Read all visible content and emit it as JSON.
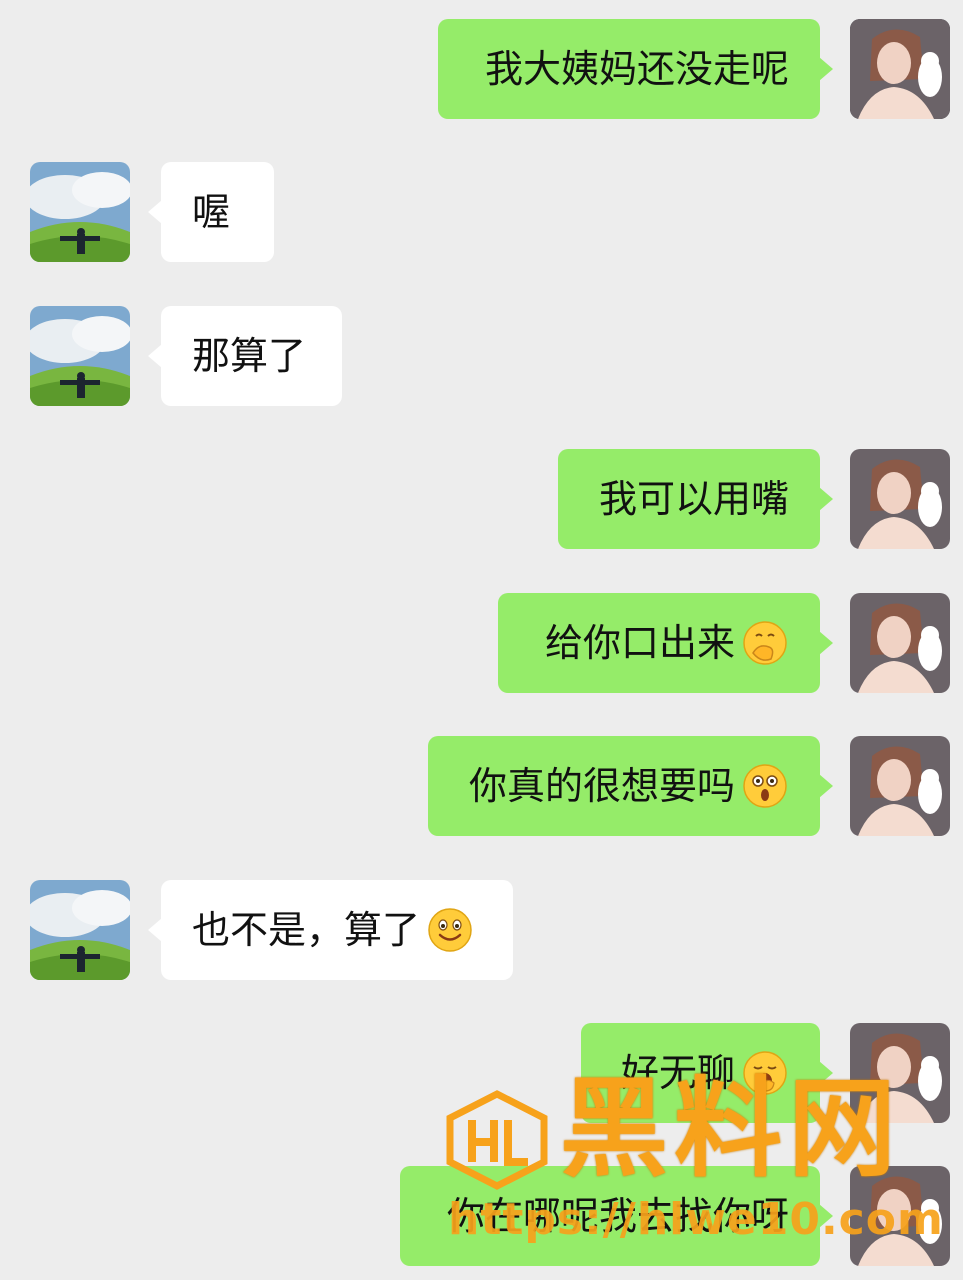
{
  "messages": [
    {
      "side": "right",
      "text": "我大姨妈还没走呢",
      "emoji": ""
    },
    {
      "side": "left",
      "text": "喔",
      "emoji": ""
    },
    {
      "side": "left",
      "text": "那算了",
      "emoji": ""
    },
    {
      "side": "right",
      "text": "我可以用嘴",
      "emoji": ""
    },
    {
      "side": "right",
      "text": "给你口出来",
      "emoji": "hand-over-mouth-emoji"
    },
    {
      "side": "right",
      "text": "你真的很想要吗",
      "emoji": "astonished-emoji"
    },
    {
      "side": "left",
      "text": "也不是，算了",
      "emoji": "smiling-face-emoji"
    },
    {
      "side": "right",
      "text": "好无聊",
      "emoji": "yawning-face-emoji"
    },
    {
      "side": "right",
      "text": "你在哪呢我去找你呀",
      "emoji": ""
    }
  ],
  "watermark": {
    "title": "黑料网",
    "url": "https://hlwe10.com"
  },
  "colors": {
    "background": "#ededed",
    "self_bubble": "#95ec69",
    "other_bubble": "#ffffff",
    "watermark": "#f7a21b"
  }
}
